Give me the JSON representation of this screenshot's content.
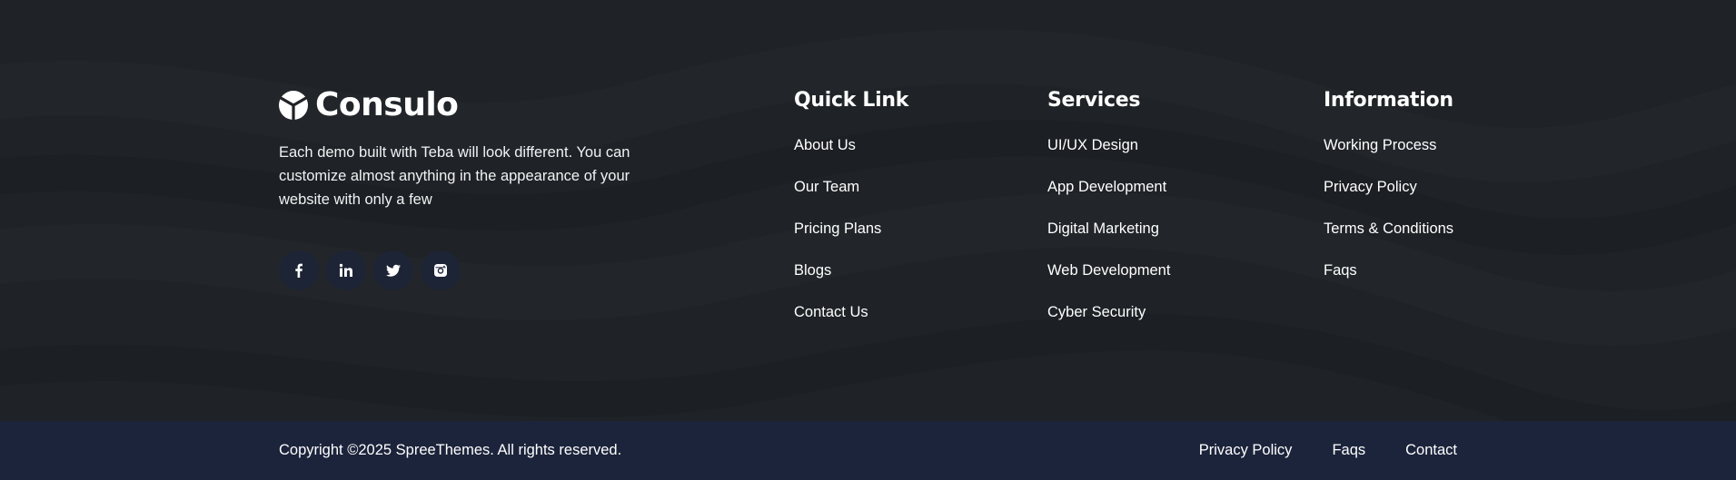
{
  "theme": {
    "footer_bg": "#1f2226",
    "bottom_bar_bg": "#1c243b",
    "social_bg": "#1d2435",
    "text": "#ffffff"
  },
  "brand": {
    "name": "Consulo",
    "logo_icon": "logo-mark-icon"
  },
  "about": {
    "text": "Each demo built with Teba will look different. You can customize almost anything in the appearance of your website with only a few"
  },
  "socials": [
    {
      "name": "facebook",
      "icon": "facebook-icon"
    },
    {
      "name": "linkedin",
      "icon": "linkedin-icon"
    },
    {
      "name": "twitter",
      "icon": "twitter-icon"
    },
    {
      "name": "instagram",
      "icon": "instagram-icon"
    }
  ],
  "columns": {
    "quick_link": {
      "title": "Quick Link",
      "links": [
        "About Us",
        "Our Team",
        "Pricing Plans",
        "Blogs",
        "Contact Us"
      ]
    },
    "services": {
      "title": "Services",
      "links": [
        "UI/UX Design",
        "App Development",
        "Digital Marketing",
        "Web Development",
        "Cyber Security"
      ]
    },
    "information": {
      "title": "Information",
      "links": [
        "Working Process",
        "Privacy Policy",
        "Terms & Conditions",
        "Faqs"
      ]
    }
  },
  "bottom": {
    "copyright": "Copyright ©2025 SpreeThemes. All rights reserved.",
    "links": [
      "Privacy Policy",
      "Faqs",
      "Contact"
    ]
  }
}
